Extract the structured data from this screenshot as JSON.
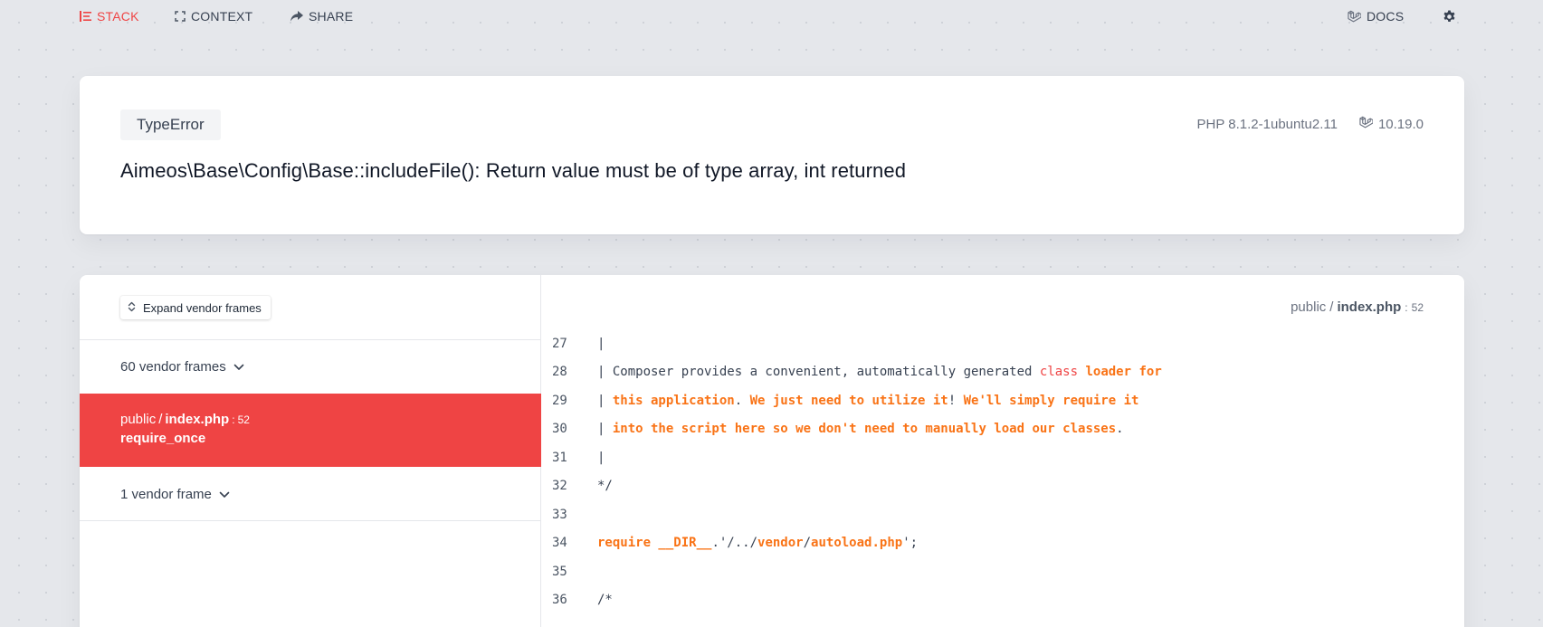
{
  "nav": {
    "stack": "STACK",
    "context": "CONTEXT",
    "share": "SHARE",
    "docs": "DOCS"
  },
  "exception": {
    "type": "TypeError",
    "message": "Aimeos\\Base\\Config\\Base::includeFile(): Return value must be of type array, int returned",
    "php_version": "PHP 8.1.2-1ubuntu2.11",
    "laravel_version": "10.19.0"
  },
  "frames": {
    "expand_label": "Expand vendor frames",
    "group_top": "60 vendor frames",
    "group_bottom": "1 vendor frame",
    "selected": {
      "dir": "public",
      "sep": "/",
      "file": "index.php",
      "colon": ":",
      "line": "52",
      "method": "require_once"
    }
  },
  "code": {
    "file_dir": "public",
    "file_sep": "/",
    "file_name": "index.php",
    "file_colon": ":",
    "file_line": "52",
    "lines": [
      {
        "num": "27",
        "tokens": [
          {
            "t": "| ",
            "c": "plain"
          }
        ]
      },
      {
        "num": "28",
        "tokens": [
          {
            "t": "| Composer provides a convenient, automatically generated ",
            "c": "plain"
          },
          {
            "t": "class",
            "c": "red"
          },
          {
            "t": " ",
            "c": "plain"
          },
          {
            "t": "loader for",
            "c": "kw"
          }
        ]
      },
      {
        "num": "29",
        "tokens": [
          {
            "t": "| ",
            "c": "plain"
          },
          {
            "t": "this application",
            "c": "kw"
          },
          {
            "t": ". ",
            "c": "plain"
          },
          {
            "t": "We just need to utilize it",
            "c": "kw"
          },
          {
            "t": "! ",
            "c": "plain"
          },
          {
            "t": "We'll simply require it",
            "c": "kw"
          }
        ]
      },
      {
        "num": "30",
        "tokens": [
          {
            "t": "| ",
            "c": "plain"
          },
          {
            "t": "into the script here so we don't need to manually load our classes",
            "c": "kw"
          },
          {
            "t": ".",
            "c": "plain"
          }
        ]
      },
      {
        "num": "31",
        "tokens": [
          {
            "t": "|",
            "c": "plain"
          }
        ]
      },
      {
        "num": "32",
        "tokens": [
          {
            "t": "*/",
            "c": "plain"
          }
        ]
      },
      {
        "num": "33",
        "tokens": [
          {
            "t": "",
            "c": "plain"
          }
        ]
      },
      {
        "num": "34",
        "tokens": [
          {
            "t": "require __DIR__",
            "c": "kw"
          },
          {
            "t": ".'/../",
            "c": "plain"
          },
          {
            "t": "vendor",
            "c": "kw"
          },
          {
            "t": "/",
            "c": "plain"
          },
          {
            "t": "autoload.php",
            "c": "kw"
          },
          {
            "t": "';",
            "c": "plain"
          }
        ]
      },
      {
        "num": "35",
        "tokens": [
          {
            "t": "",
            "c": "plain"
          }
        ]
      },
      {
        "num": "36",
        "tokens": [
          {
            "t": "/*",
            "c": "plain"
          }
        ]
      }
    ]
  },
  "colors": {
    "accent": "#ef4444",
    "keyword": "#f97316",
    "background": "#e5e7eb"
  }
}
